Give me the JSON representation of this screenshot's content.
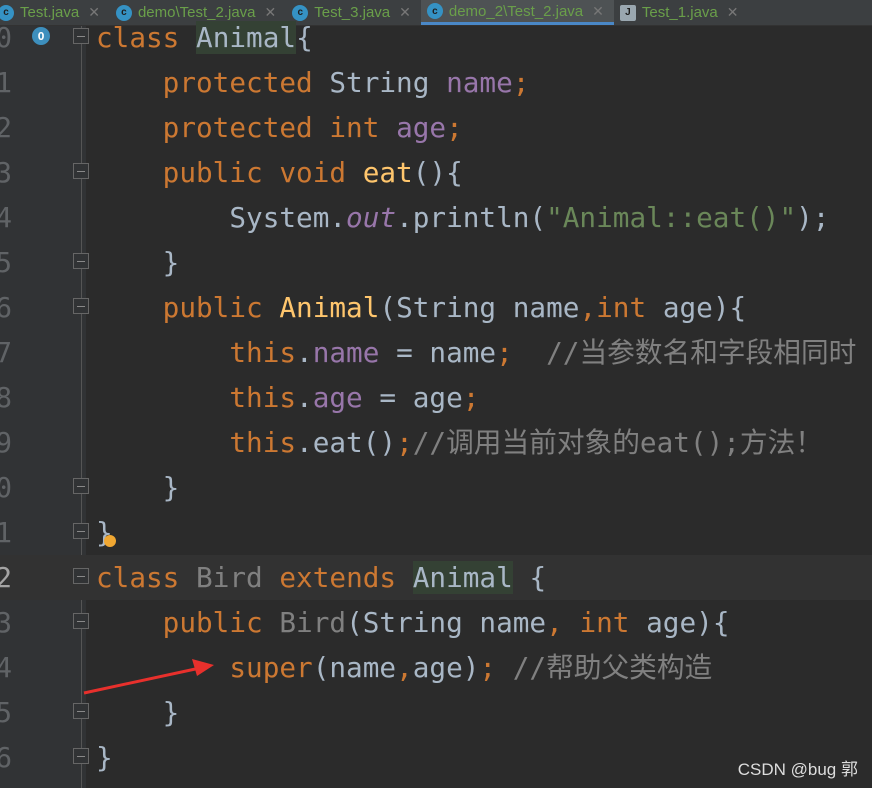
{
  "tabs": [
    {
      "label": "Test.java",
      "icon": "class-icon",
      "active": false
    },
    {
      "label": "demo\\Test_2.java",
      "icon": "class-icon",
      "active": false
    },
    {
      "label": "Test_3.java",
      "icon": "class-icon",
      "active": false
    },
    {
      "label": "demo_2\\Test_2.java",
      "icon": "class-icon",
      "active": true
    },
    {
      "label": "Test_1.java",
      "icon": "java-file-icon",
      "active": false
    }
  ],
  "current_line": 12,
  "lines": [
    {
      "n": "0",
      "fold": true,
      "t": [
        [
          "class ",
          "kw"
        ],
        [
          "Animal",
          "hl"
        ],
        [
          "{",
          ""
        ]
      ]
    },
    {
      "n": "1",
      "t": [
        [
          "    protected ",
          "kw"
        ],
        [
          "String ",
          ""
        ],
        [
          "name",
          "fd"
        ],
        [
          ";",
          "kw"
        ]
      ]
    },
    {
      "n": "2",
      "t": [
        [
          "    protected int ",
          "kw"
        ],
        [
          "age",
          "fd"
        ],
        [
          ";",
          "kw"
        ]
      ]
    },
    {
      "n": "3",
      "fold": true,
      "t": [
        [
          "    public void ",
          "kw"
        ],
        [
          "eat",
          "md"
        ],
        [
          "(){",
          ""
        ]
      ]
    },
    {
      "n": "4",
      "t": [
        [
          "        System.",
          ""
        ],
        [
          "out",
          "it"
        ],
        [
          ".println(",
          ""
        ],
        [
          "\"Animal::eat()\"",
          "st"
        ],
        [
          ");",
          ""
        ]
      ]
    },
    {
      "n": "5",
      "fold": true,
      "t": [
        [
          "    }",
          ""
        ]
      ]
    },
    {
      "n": "6",
      "fold": true,
      "t": [
        [
          "    public ",
          "kw"
        ],
        [
          "Animal",
          "md"
        ],
        [
          "(String name",
          ""
        ],
        [
          ",int ",
          "kw"
        ],
        [
          "age){",
          ""
        ]
      ]
    },
    {
      "n": "7",
      "t": [
        [
          "        this",
          "kw"
        ],
        [
          ".",
          ""
        ],
        [
          "name",
          "fd"
        ],
        [
          " = name",
          ""
        ],
        [
          ";",
          "kw"
        ],
        [
          "  //当参数名和字段相同时",
          "cm"
        ]
      ]
    },
    {
      "n": "8",
      "t": [
        [
          "        this",
          "kw"
        ],
        [
          ".",
          ""
        ],
        [
          "age",
          "fd"
        ],
        [
          " = age",
          ""
        ],
        [
          ";",
          "kw"
        ]
      ]
    },
    {
      "n": "9",
      "t": [
        [
          "        this",
          "kw"
        ],
        [
          ".eat()",
          ""
        ],
        [
          ";",
          "kw"
        ],
        [
          "//调用当前对象的eat();方法！",
          "cm"
        ]
      ]
    },
    {
      "n": "0",
      "fold": true,
      "t": [
        [
          "    }",
          ""
        ]
      ]
    },
    {
      "n": "1",
      "fold": true,
      "t": [
        [
          "}",
          ""
        ]
      ]
    },
    {
      "n": "2",
      "fold": true,
      "t": [
        [
          "class ",
          "kw"
        ],
        [
          "Bird ",
          "un"
        ],
        [
          "extends ",
          "kw"
        ],
        [
          "Animal",
          "hl"
        ],
        [
          " {",
          ""
        ]
      ]
    },
    {
      "n": "3",
      "fold": true,
      "t": [
        [
          "    public ",
          "kw"
        ],
        [
          "Bird",
          "un"
        ],
        [
          "(String name",
          ""
        ],
        [
          ", int ",
          "kw"
        ],
        [
          "age){",
          ""
        ]
      ]
    },
    {
      "n": "4",
      "t": [
        [
          "        super",
          "kw"
        ],
        [
          "(name",
          ""
        ],
        [
          ",",
          "kw"
        ],
        [
          "age)",
          ""
        ],
        [
          "; ",
          "kw"
        ],
        [
          "//帮助父类构造",
          "cm"
        ]
      ]
    },
    {
      "n": "5",
      "fold": true,
      "t": [
        [
          "    }",
          ""
        ]
      ]
    },
    {
      "n": "6",
      "fold": true,
      "t": [
        [
          "}",
          ""
        ]
      ]
    }
  ],
  "watermark": "CSDN @bug 郭",
  "colors": {
    "keyword": "#cc7832",
    "field": "#9876aa",
    "string": "#6a8759",
    "comment": "#808080",
    "method": "#ffc66d",
    "arrow": "#e8302c"
  }
}
